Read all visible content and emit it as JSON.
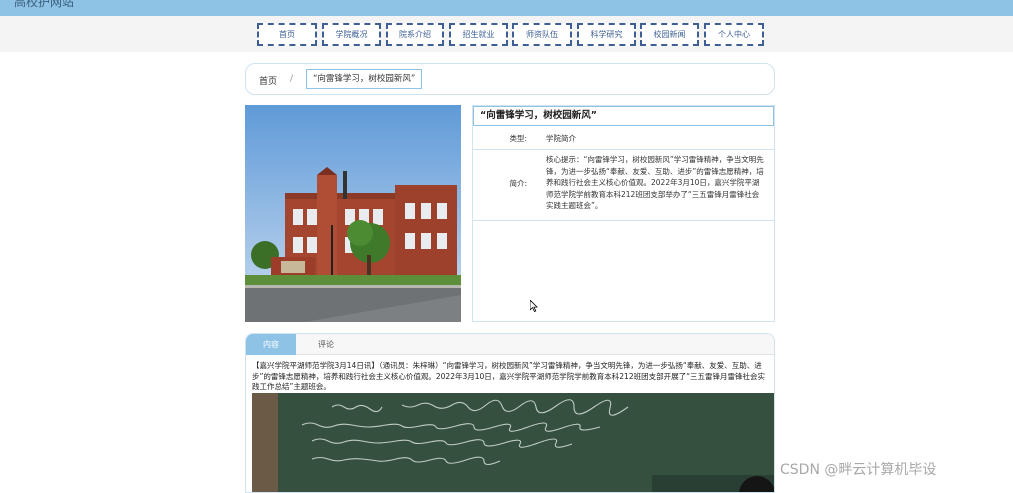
{
  "site": {
    "title": "高校护网站"
  },
  "nav": {
    "items": [
      {
        "label": "首页"
      },
      {
        "label": "学院概况"
      },
      {
        "label": "院系介绍"
      },
      {
        "label": "招生就业"
      },
      {
        "label": "师资队伍"
      },
      {
        "label": "科学研究"
      },
      {
        "label": "校园新闻"
      },
      {
        "label": "个人中心"
      }
    ]
  },
  "breadcrumb": {
    "home": "首页",
    "separator": "/",
    "current": "“向雷锋学习，树校园新风”"
  },
  "detail": {
    "title": "“向雷锋学习，树校园新风”",
    "type_label": "类型:",
    "type_value": "学院简介",
    "intro_label": "简介:",
    "intro_text": "核心提示：“向雷锋学习，树校园新风”学习雷锋精神，争当文明先锋，为进一步弘扬“奉献、友爱、互助、进步”的雷锋志愿精神，培养和践行社会主义核心价值观。2022年3月10日，嘉兴学院平湖师范学院学前教育本科212班团支部举办了“三五雷锋月雷锋社会实践主题班会”。"
  },
  "tabs": {
    "content": "内容",
    "comment": "评论"
  },
  "article": {
    "text": "【嘉兴学院平湖师范学院3月14日讯】（通讯员：朱梓琳）“向雷锋学习，树校园新风”学习雷锋精神，争当文明先锋，为进一步弘扬“奉献、友爱、互助、进步”的雷锋志愿精神，培养和践行社会主义核心价值观。2022年3月10日，嘉兴学院平湖师范学院学前教育本科212班团支部开展了“三五雷锋月雷锋社会实践工作总结”主题班会。"
  },
  "watermark": "CSDN @畔云计算机毕设",
  "colors": {
    "accent": "#8fc3e6",
    "nav_border": "#3d5f94",
    "panel_border": "#cfe3f0"
  }
}
